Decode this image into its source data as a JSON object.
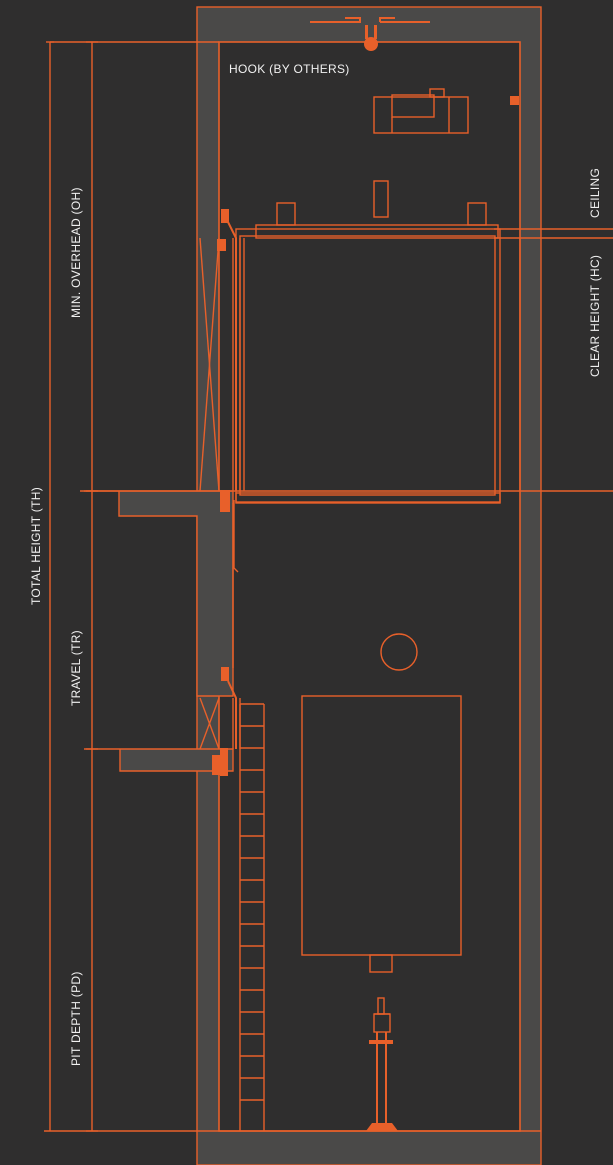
{
  "labels": {
    "hook": "HOOK (BY OTHERS)",
    "ceiling": "CEILING",
    "clear_height": "CLEAR HEIGHT (HC)",
    "total_height": "TOTAL HEIGHT (TH)",
    "min_overhead": "MIN. OVERHEAD  (OH)",
    "travel": "TRAVEL (TR)",
    "pit_depth": "PIT DEPTH (PD)"
  },
  "colors": {
    "background": "#2f2e2e",
    "line": "#e8602a",
    "wall_fill": "#4a4948",
    "text": "#f1f1f1"
  }
}
